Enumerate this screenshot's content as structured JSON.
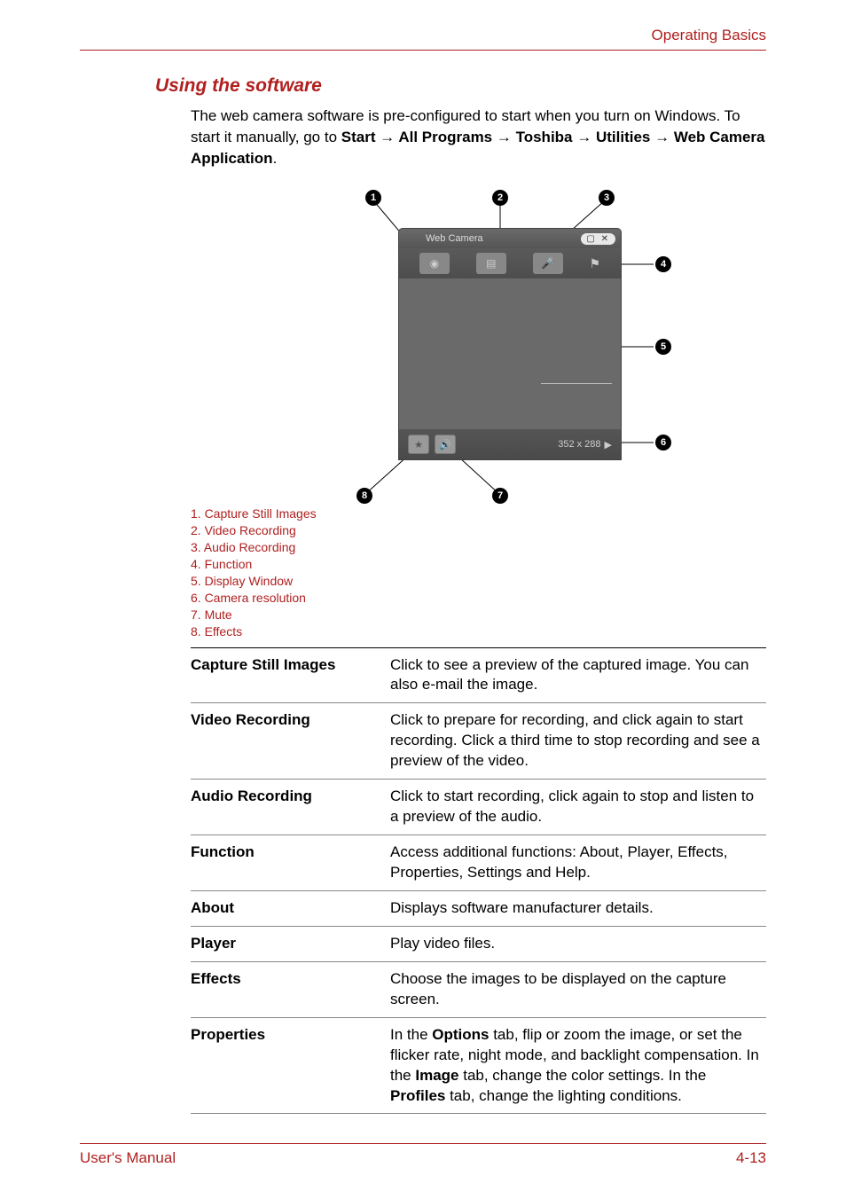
{
  "header": {
    "section": "Operating Basics"
  },
  "title": "Using the software",
  "intro": {
    "line1": "The web camera software is pre-configured to start when you turn on Windows. To start it manually, go to ",
    "start": "Start",
    "arrow": " → ",
    "all_programs": "All Programs",
    "toshiba": "Toshiba",
    "utilities": "Utilities",
    "app": "Web Camera Application",
    "period": "."
  },
  "app": {
    "title": "Web Camera",
    "resolution": "352 x 288"
  },
  "legend_items": [
    "1.  Capture Still Images",
    "2.  Video Recording",
    "3.  Audio Recording",
    "4.  Function",
    "5.  Display Window",
    "6.  Camera resolution",
    "7.  Mute",
    "8.  Effects"
  ],
  "defs": [
    {
      "term": "Capture Still Images",
      "desc": "Click to see a preview of the captured image. You can also e-mail the image."
    },
    {
      "term": "Video Recording",
      "desc": "Click to prepare for recording, and click again to start recording. Click a third time to stop recording and see a preview of the video."
    },
    {
      "term": "Audio Recording",
      "desc": "Click to start recording, click again to stop and listen to a preview of the audio."
    },
    {
      "term": "Function",
      "desc": "Access additional functions: About, Player, Effects, Properties, Settings and Help."
    },
    {
      "term": "About",
      "desc": "Displays software manufacturer details."
    },
    {
      "term": "Player",
      "desc": "Play video files."
    },
    {
      "term": "Effects",
      "desc": "Choose the images to be displayed on the capture screen."
    }
  ],
  "properties_row": {
    "term": "Properties",
    "p1": "In the ",
    "options": "Options",
    "p2": " tab, flip or zoom the image, or set the flicker rate, night mode, and backlight compensation. In the ",
    "image": "Image",
    "p3": " tab, change the color settings. In the ",
    "profiles": "Profiles",
    "p4": " tab, change the lighting conditions."
  },
  "footer": {
    "left": "User's Manual",
    "right": "4-13"
  }
}
